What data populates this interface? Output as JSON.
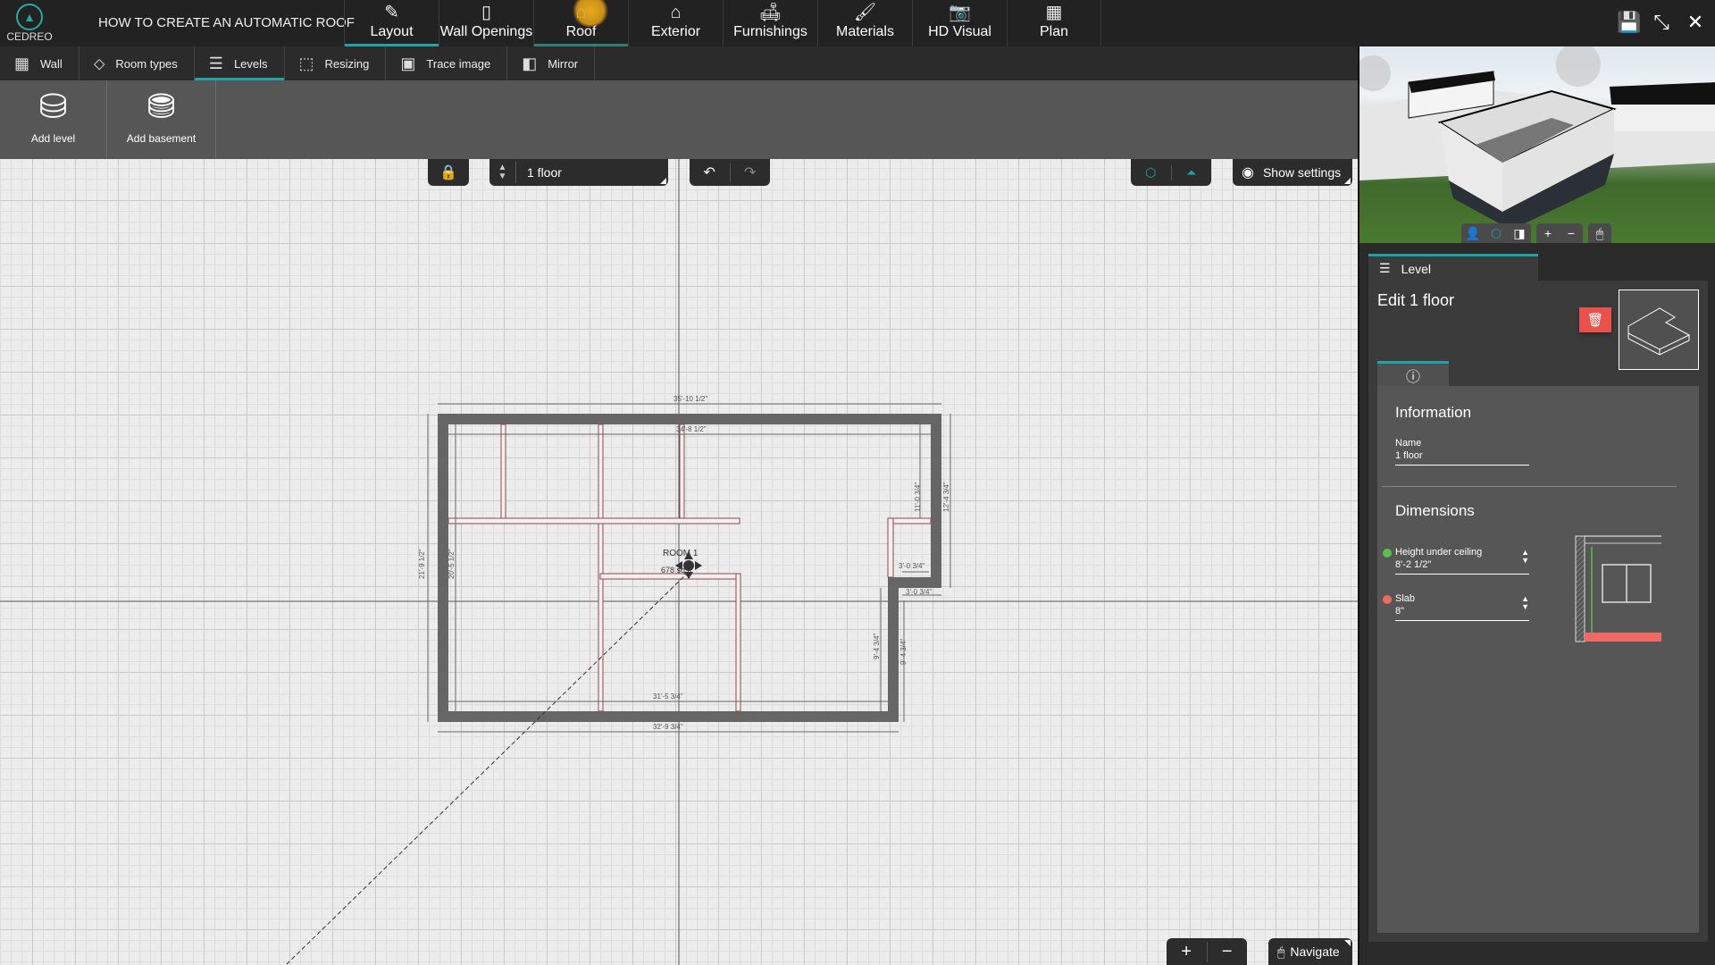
{
  "app": {
    "logo_text": "CEDREO",
    "project_title": "HOW TO CREATE AN AUTOMATIC ROOF"
  },
  "main_tabs": [
    {
      "label": "Layout",
      "icon": "pencil-icon",
      "glyph": "✎",
      "state": "active"
    },
    {
      "label": "Wall Openings",
      "icon": "door-icon",
      "glyph": "▯",
      "state": ""
    },
    {
      "label": "Roof",
      "icon": "roof-icon",
      "glyph": "⌂",
      "state": "hover"
    },
    {
      "label": "Exterior",
      "icon": "house-exterior-icon",
      "glyph": "⌂",
      "state": ""
    },
    {
      "label": "Furnishings",
      "icon": "lamp-sofa-icon",
      "glyph": "🛋",
      "state": ""
    },
    {
      "label": "Materials",
      "icon": "paint-roller-icon",
      "glyph": "🖌",
      "state": ""
    },
    {
      "label": "HD Visual",
      "icon": "camera-icon",
      "glyph": "📷",
      "state": ""
    },
    {
      "label": "Plan",
      "icon": "blueprint-icon",
      "glyph": "▦",
      "state": ""
    }
  ],
  "window_controls": {
    "save": "💾",
    "collapse": "⤡",
    "close": "✕"
  },
  "sub_tabs": [
    {
      "label": "Wall",
      "icon": "brick-wall-icon",
      "glyph": "▦"
    },
    {
      "label": "Room types",
      "icon": "tag-icon",
      "glyph": "⬦"
    },
    {
      "label": "Levels",
      "icon": "levels-stack-icon",
      "glyph": "☰",
      "active": true
    },
    {
      "label": "Resizing",
      "icon": "resize-icon",
      "glyph": "⬚"
    },
    {
      "label": "Trace image",
      "icon": "trace-image-icon",
      "glyph": "▣"
    },
    {
      "label": "Mirror",
      "icon": "mirror-icon",
      "glyph": "◧"
    }
  ],
  "ribbon": {
    "add_level": {
      "label": "Add level",
      "glyph": "⛁"
    },
    "add_basement": {
      "label": "Add basement",
      "glyph": "⛃"
    }
  },
  "canvas_controls": {
    "lock": "🔒",
    "level_select_value": "1 floor",
    "undo": "↶",
    "redo": "↷",
    "view_3d": "⬡",
    "view_2d": "⏶",
    "show_settings_label": "Show settings",
    "zoom_in": "+",
    "zoom_out": "−",
    "navigate_label": "Navigate"
  },
  "floor_plan": {
    "room_label": "ROOM 1",
    "room_area": "678 sq ft",
    "dimensions": {
      "top_outer": "35'-10 1/2\"",
      "top_inner": "34'-8 1/2\"",
      "left_outer": "21'-9 1/2\"",
      "left_inner": "20'-5 1/2\"",
      "right_upper_inner": "11'-0 3/4\"",
      "right_upper_outer": "12'-4 3/4\"",
      "notch_top": "3'-0 3/4\"",
      "notch_bottom": "3'-0 3/4\"",
      "right_lower_inner": "9'-4 3/4\"",
      "right_lower_outer": "9'-4 3/4\"",
      "bottom_inner": "31'-5 3/4\"",
      "bottom_outer": "32'-9 3/4\""
    }
  },
  "view3d_toolbar": {
    "person": "👤",
    "box": "⬡",
    "plan": "◨",
    "plus": "+",
    "minus": "−",
    "mouse": "🖱"
  },
  "panel": {
    "tab_label": "Level",
    "edit_title": "Edit 1 floor",
    "delete_glyph": "🗑",
    "info_glyph": "ⓘ",
    "information_title": "Information",
    "name_label": "Name",
    "name_value": "1 floor",
    "dimensions_title": "Dimensions",
    "height_label": "Height under ceiling",
    "height_value": "8'-2 1/2\"",
    "height_color": "#5cbf4f",
    "slab_label": "Slab",
    "slab_value": "8\"",
    "slab_color": "#f06a63"
  }
}
